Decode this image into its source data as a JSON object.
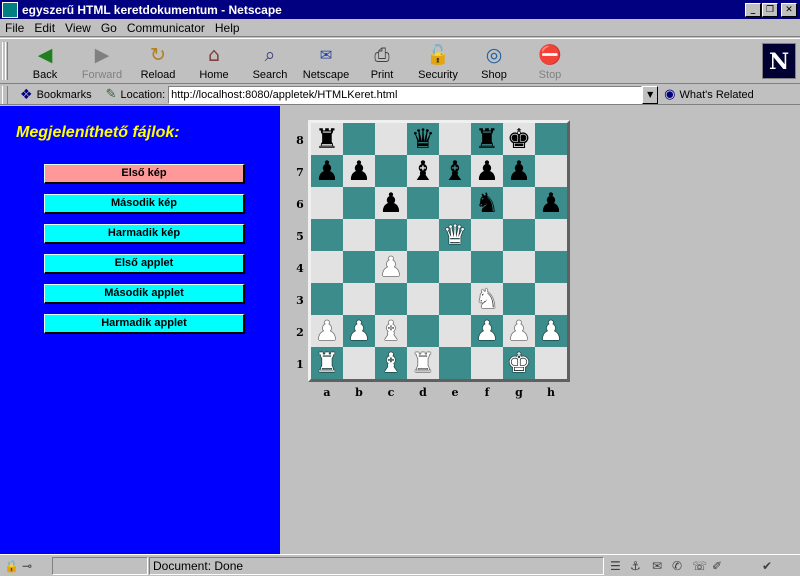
{
  "window": {
    "title": "egyszerű HTML keretdokumentum - Netscape"
  },
  "menu": [
    {
      "label": "File",
      "key": "F"
    },
    {
      "label": "Edit",
      "key": "E"
    },
    {
      "label": "View",
      "key": "V"
    },
    {
      "label": "Go",
      "key": "G"
    },
    {
      "label": "Communicator",
      "key": "C"
    },
    {
      "label": "Help",
      "key": "H"
    }
  ],
  "toolbar": {
    "back": "Back",
    "forward": "Forward",
    "reload": "Reload",
    "home": "Home",
    "search": "Search",
    "netscape": "Netscape",
    "print": "Print",
    "security": "Security",
    "shop": "Shop",
    "stop": "Stop",
    "logo": "N"
  },
  "location": {
    "bookmarks_label": "Bookmarks",
    "location_label": "Location:",
    "url": "http://localhost:8080/appletek/HTMLKeret.html",
    "whats_related": "What's Related"
  },
  "left_frame": {
    "heading": "Megjeleníthető fájlok:",
    "buttons": [
      "Első kép",
      "Második kép",
      "Harmadik kép",
      "Első applet",
      "Második applet",
      "Harmadik applet"
    ],
    "active_index": 0,
    "background": "#0000ff",
    "heading_color": "#ffff00",
    "button_color": "#00ffff",
    "active_button_color": "#ff9999"
  },
  "chess": {
    "light_color": "#e2e2e2",
    "dark_color": "#3c8c8c",
    "files": [
      "a",
      "b",
      "c",
      "d",
      "e",
      "f",
      "g",
      "h"
    ],
    "ranks": [
      "8",
      "7",
      "6",
      "5",
      "4",
      "3",
      "2",
      "1"
    ],
    "position": [
      [
        "br",
        "",
        "",
        "bq",
        "",
        "br",
        "bk",
        ""
      ],
      [
        "bp",
        "bp",
        "",
        "bb",
        "bb",
        "bp",
        "bp",
        ""
      ],
      [
        "",
        "",
        "bp",
        "",
        "",
        "bn",
        "",
        "bp"
      ],
      [
        "",
        "",
        "",
        "",
        "wq",
        "",
        "",
        ""
      ],
      [
        "",
        "",
        "wp",
        "",
        "",
        "",
        "",
        ""
      ],
      [
        "",
        "",
        "",
        "",
        "",
        "wn",
        "",
        ""
      ],
      [
        "wp",
        "wp",
        "wb",
        "",
        "",
        "wp",
        "wp",
        "wp"
      ],
      [
        "wr",
        "",
        "wb",
        "wr",
        "",
        "",
        "wk",
        ""
      ]
    ]
  },
  "status": {
    "text": "Document: Done"
  }
}
